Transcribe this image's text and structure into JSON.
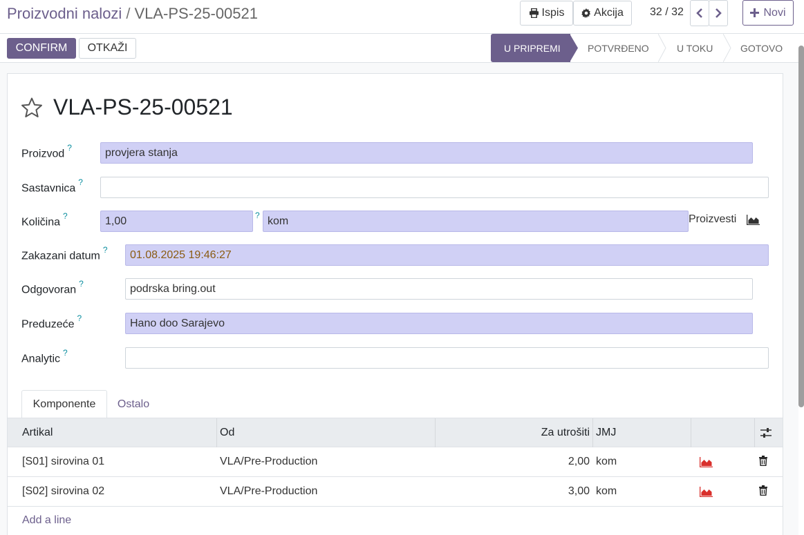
{
  "breadcrumb": {
    "parent": "Proizvodni nalozi",
    "separator": "/",
    "current": "VLA-PS-25-00521"
  },
  "toolbar": {
    "print_label": "Ispis",
    "action_label": "Akcija",
    "new_label": "Novi"
  },
  "pager": {
    "value": "32 / 32"
  },
  "statusbar": {
    "confirm_label": "CONFIRM",
    "cancel_label": "OTKAŽI",
    "stages": [
      {
        "label": "U PRIPREMI",
        "active": true
      },
      {
        "label": "POTVRĐENO",
        "active": false
      },
      {
        "label": "U TOKU",
        "active": false
      },
      {
        "label": "GOTOVO",
        "active": false
      }
    ]
  },
  "record": {
    "title": "VLA-PS-25-00521",
    "help_mark": "?",
    "fields": {
      "product": {
        "label": "Proizvod",
        "value": "provjera stanja"
      },
      "bom": {
        "label": "Sastavnica",
        "value": ""
      },
      "quantity": {
        "label": "Količina",
        "value": "1,00",
        "uom": "kom",
        "produce_label": "Proizvesti"
      },
      "date": {
        "label": "Zakazani datum",
        "value": "01.08.2025 19:46:27"
      },
      "responsible": {
        "label": "Odgovoran",
        "value": "podrska bring.out"
      },
      "company": {
        "label": "Preduzeće",
        "value": "Hano doo Sarajevo"
      },
      "analytic": {
        "label": "Analytic",
        "value": ""
      }
    }
  },
  "tabs": [
    {
      "label": "Komponente",
      "active": true
    },
    {
      "label": "Ostalo",
      "active": false
    }
  ],
  "components": {
    "headers": {
      "product": "Artikal",
      "from": "Od",
      "to_consume": "Za utrošiti",
      "uom": "JMJ"
    },
    "rows": [
      {
        "product": "[S01] sirovina 01",
        "from": "VLA/Pre-Production",
        "to_consume": "2,00",
        "uom": "kom"
      },
      {
        "product": "[S02] sirovina 02",
        "from": "VLA/Pre-Production",
        "to_consume": "3,00",
        "uom": "kom"
      }
    ],
    "add_line_label": "Add a line"
  },
  "colors": {
    "primary": "#6c5f8c",
    "required_bg": "#d0d0f5",
    "help": "#0d8fa0",
    "forecast_red": "#d9302c"
  },
  "icons": [
    "print-icon",
    "gear-icon",
    "chevron-left-icon",
    "chevron-right-icon",
    "plus-icon",
    "star-icon",
    "area-chart-icon",
    "trash-icon",
    "settings-sliders-icon"
  ]
}
